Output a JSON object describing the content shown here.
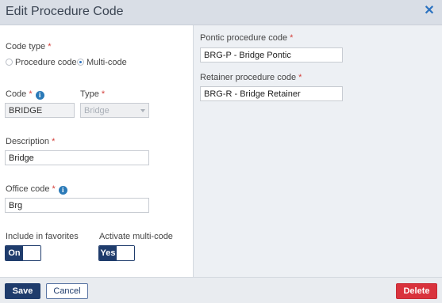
{
  "header": {
    "title": "Edit Procedure Code",
    "close_symbol": "✕"
  },
  "code_type": {
    "label": "Code type",
    "required_mark": "*",
    "options": [
      {
        "label": "Procedure code",
        "selected": false
      },
      {
        "label": "Multi-code",
        "selected": true
      }
    ]
  },
  "code": {
    "label": "Code",
    "required_mark": "*",
    "value": "BRIDGE",
    "info_icon": "info-icon"
  },
  "type": {
    "label": "Type",
    "required_mark": "*",
    "value": "Bridge"
  },
  "description": {
    "label": "Description",
    "required_mark": "*",
    "value": "Bridge"
  },
  "office_code": {
    "label": "Office code",
    "required_mark": "*",
    "value": "Brg",
    "info_icon": "info-icon"
  },
  "favorites": {
    "label": "Include in favorites",
    "toggle_label": "On",
    "value": true
  },
  "multi_code": {
    "label": "Activate multi-code",
    "toggle_label": "Yes",
    "value": true
  },
  "pontic": {
    "label": "Pontic procedure code",
    "required_mark": "*",
    "value": "BRG-P - Bridge Pontic"
  },
  "retainer": {
    "label": "Retainer procedure code",
    "required_mark": "*",
    "value": "BRG-R - Bridge Retainer"
  },
  "footer": {
    "save_label": "Save",
    "cancel_label": "Cancel",
    "delete_label": "Delete"
  },
  "colors": {
    "primary": "#1f3c6c",
    "danger": "#d9333d",
    "link": "#2b72c0",
    "required": "#d43f3a"
  }
}
